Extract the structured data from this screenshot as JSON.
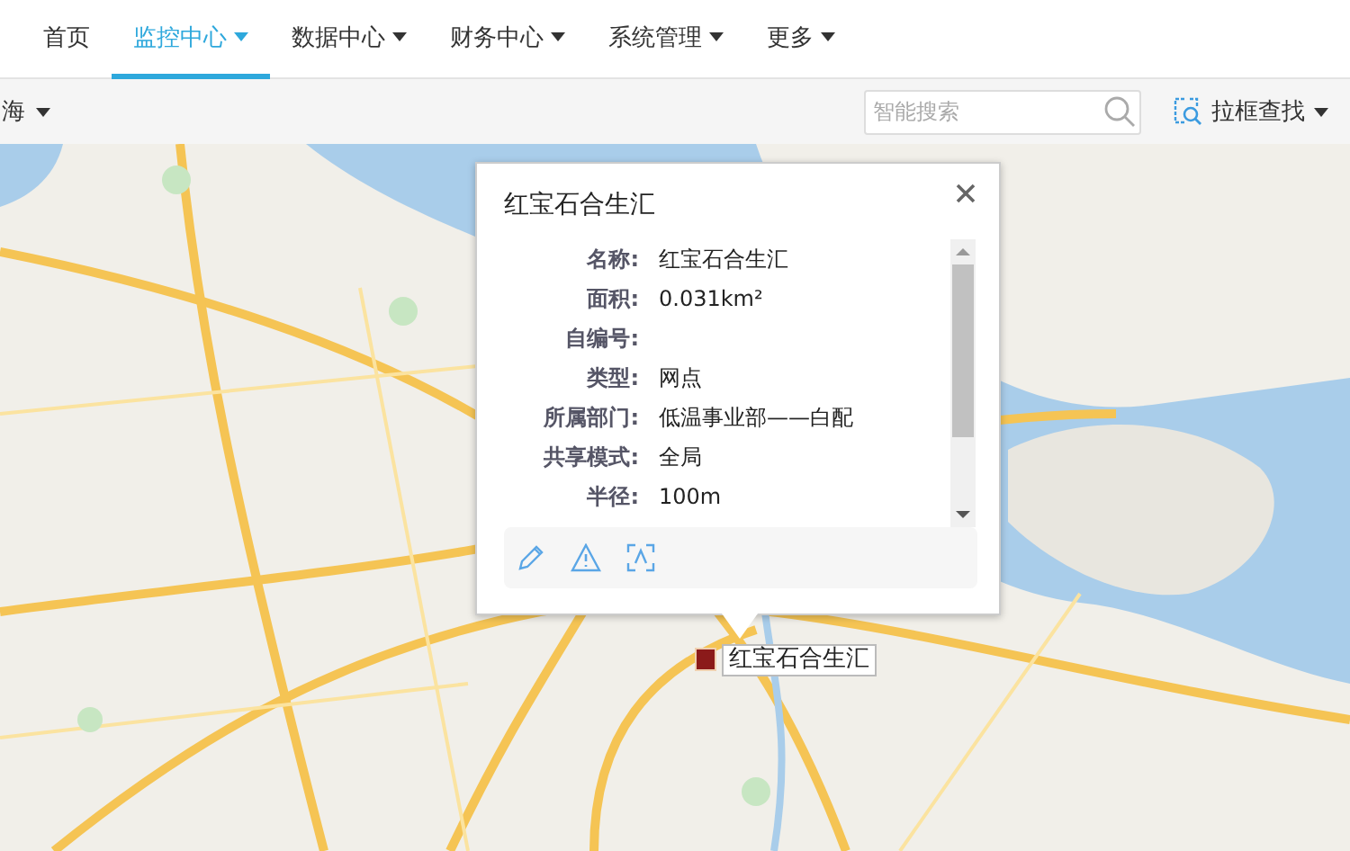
{
  "nav": {
    "tabs": [
      {
        "label": "首页",
        "dropdown": false,
        "selected": false
      },
      {
        "label": "监控中心",
        "dropdown": true,
        "selected": true
      },
      {
        "label": "数据中心",
        "dropdown": true,
        "selected": false
      },
      {
        "label": "财务中心",
        "dropdown": true,
        "selected": false
      },
      {
        "label": "系统管理",
        "dropdown": true,
        "selected": false
      },
      {
        "label": "更多",
        "dropdown": true,
        "selected": false
      }
    ]
  },
  "toolbar": {
    "region_dropdown": "海",
    "search": {
      "placeholder": "智能搜索"
    },
    "box_search_button": "拉框查找"
  },
  "map": {
    "marker_label": "红宝石合生汇",
    "popup": {
      "title": "红宝石合生汇",
      "fields": [
        {
          "label": "名称:",
          "value": "红宝石合生汇"
        },
        {
          "label": "面积:",
          "value": "0.031km²"
        },
        {
          "label": "自编号:"
        },
        {
          "label": "类型:",
          "value": "网点"
        },
        {
          "label": "所属部门:",
          "value": "低温事业部——白配"
        },
        {
          "label": "共享模式:",
          "value": "全局"
        },
        {
          "label": "半径:",
          "value": "100m"
        }
      ]
    }
  }
}
